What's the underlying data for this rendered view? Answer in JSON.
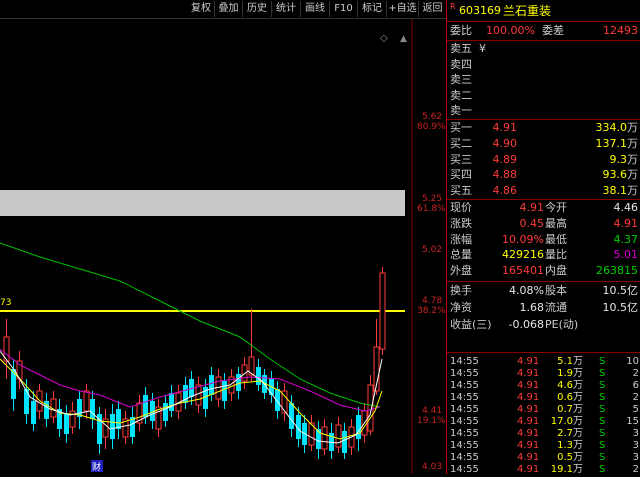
{
  "toolbar": {
    "buttons": [
      "复权",
      "叠加",
      "历史",
      "统计",
      "画线",
      "F10",
      "标记",
      "+自选",
      "返回"
    ]
  },
  "chart": {
    "price_labels": [
      "5.62",
      "5.25",
      "5.02",
      "4.78",
      "4.41",
      "4.03"
    ],
    "pct_labels": [
      "80.9%",
      "61.8%",
      "38.2%",
      "19.1%"
    ],
    "left_marker": "73",
    "bottom_marker": "财",
    "diamond": "◇",
    "scroll_arrow": "▲",
    "colors": {
      "up": "#ff3a3a",
      "down": "#00e5ff",
      "ma5": "#ffffff",
      "ma10": "#ffff00",
      "ma20": "#d400d4",
      "ma60": "#00c000",
      "fib": "#ffff00",
      "band": "#c8c8c8"
    }
  },
  "stock": {
    "badge": "R",
    "code": "603169",
    "name": "兰石重装"
  },
  "weibi": {
    "label1": "委比",
    "value1": "100.00%",
    "label2": "委差",
    "value2": "12493"
  },
  "sell_levels": [
    {
      "label": "卖五",
      "extra": "¥"
    },
    {
      "label": "卖四",
      "extra": ""
    },
    {
      "label": "卖三",
      "extra": ""
    },
    {
      "label": "卖二",
      "extra": ""
    },
    {
      "label": "卖一",
      "extra": ""
    }
  ],
  "buy_levels": [
    {
      "label": "买一",
      "price": "4.91",
      "vol": "334.0",
      "unit": "万"
    },
    {
      "label": "买二",
      "price": "4.90",
      "vol": "137.1",
      "unit": "万"
    },
    {
      "label": "买三",
      "price": "4.89",
      "vol": "9.3",
      "unit": "万"
    },
    {
      "label": "买四",
      "price": "4.88",
      "vol": "93.6",
      "unit": "万"
    },
    {
      "label": "买五",
      "price": "4.86",
      "vol": "38.1",
      "unit": "万"
    }
  ],
  "quote": [
    {
      "l1": "现价",
      "v1": "4.91",
      "c1": "red",
      "l2": "今开",
      "v2": "4.46",
      "c2": "white"
    },
    {
      "l1": "涨跌",
      "v1": "0.45",
      "c1": "red",
      "l2": "最高",
      "v2": "4.91",
      "c2": "red"
    },
    {
      "l1": "涨幅",
      "v1": "10.09%",
      "c1": "red",
      "l2": "最低",
      "v2": "4.37",
      "c2": "green"
    },
    {
      "l1": "总量",
      "v1": "429216",
      "c1": "yellow",
      "l2": "量比",
      "v2": "5.01",
      "c2": "purple"
    },
    {
      "l1": "外盘",
      "v1": "165401",
      "c1": "red",
      "l2": "内盘",
      "v2": "263815",
      "c2": "green"
    }
  ],
  "fundamentals": [
    {
      "l1": "换手",
      "v1": "4.08%",
      "l2": "股本",
      "v2": "10.5亿"
    },
    {
      "l1": "净资",
      "v1": "1.68",
      "l2": "流通",
      "v2": "10.5亿"
    },
    {
      "l1": "收益(三)",
      "v1": "-0.068",
      "l2": "PE(动)",
      "v2": ""
    }
  ],
  "ticks": [
    {
      "time": "14:55",
      "price": "4.91",
      "vol": "5.1",
      "unit": "万",
      "side": "S",
      "cnt": "10"
    },
    {
      "time": "14:55",
      "price": "4.91",
      "vol": "1.9",
      "unit": "万",
      "side": "S",
      "cnt": "2"
    },
    {
      "time": "14:55",
      "price": "4.91",
      "vol": "4.6",
      "unit": "万",
      "side": "S",
      "cnt": "6"
    },
    {
      "time": "14:55",
      "price": "4.91",
      "vol": "0.6",
      "unit": "万",
      "side": "S",
      "cnt": "2"
    },
    {
      "time": "14:55",
      "price": "4.91",
      "vol": "0.7",
      "unit": "万",
      "side": "S",
      "cnt": "5"
    },
    {
      "time": "14:55",
      "price": "4.91",
      "vol": "17.0",
      "unit": "万",
      "side": "S",
      "cnt": "15"
    },
    {
      "time": "14:55",
      "price": "4.91",
      "vol": "2.7",
      "unit": "万",
      "side": "S",
      "cnt": "3"
    },
    {
      "time": "14:55",
      "price": "4.91",
      "vol": "1.3",
      "unit": "万",
      "side": "S",
      "cnt": "3"
    },
    {
      "time": "14:55",
      "price": "4.91",
      "vol": "0.5",
      "unit": "万",
      "side": "S",
      "cnt": "3"
    },
    {
      "time": "14:55",
      "price": "4.91",
      "vol": "19.1",
      "unit": "万",
      "side": "S",
      "cnt": "2"
    }
  ]
}
